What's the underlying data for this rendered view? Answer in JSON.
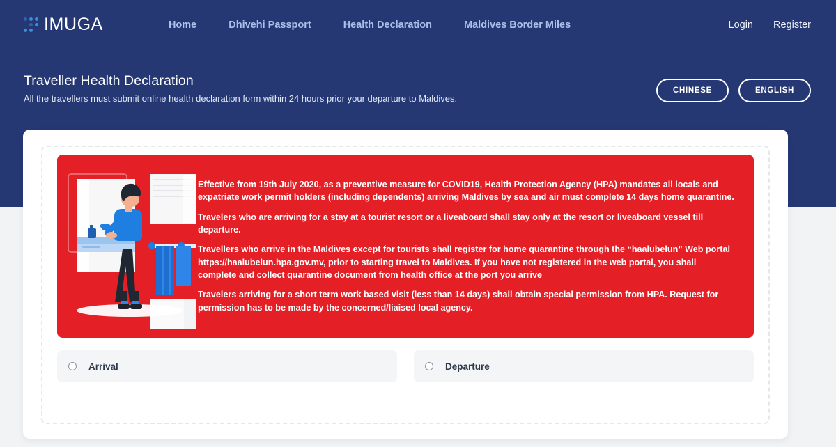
{
  "navbar": {
    "brand": "IMUGA",
    "brand_icon": "dot-grid-logo-icon",
    "links": [
      {
        "label": "Home",
        "name": "nav-link-home"
      },
      {
        "label": "Dhivehi Passport",
        "name": "nav-link-dhivehi-passport"
      },
      {
        "label": "Health Declaration",
        "name": "nav-link-health-declaration"
      },
      {
        "label": "Maldives Border Miles",
        "name": "nav-link-maldives-border-miles"
      }
    ],
    "auth": [
      {
        "label": "Login",
        "name": "login-link"
      },
      {
        "label": "Register",
        "name": "register-link"
      }
    ]
  },
  "page_header": {
    "title": "Traveller Health Declaration",
    "subtitle": "All the travellers must submit online health declaration form within 24 hours prior your departure to Maldives.",
    "language_buttons": [
      {
        "label": "CHINESE",
        "name": "language-button-chinese"
      },
      {
        "label": "ENGLISH",
        "name": "language-button-english"
      }
    ]
  },
  "notice": {
    "illustration": "handwashing-illustration",
    "paragraphs": [
      "Effective from 19th July 2020, as a preventive measure for COVID19, Health Protection Agency (HPA) mandates all locals and expatriate work permit holders (including dependents) arriving Maldives by sea and air must complete 14 days home quarantine.",
      "Travelers who are arriving for a stay at a tourist resort or a liveaboard shall stay only at the resort or liveaboard vessel till departure.",
      "Travellers who arrive in the Maldives except for tourists shall register for home quarantine through the “haalubelun” Web portal https://haalubelun.hpa.gov.mv, prior to starting travel to Maldives. If you have not registered in the web portal, you shall complete and collect quarantine document from health office at the port you arrive",
      "Travelers arriving for a short term work based visit (less than 14 days) shall obtain special permission from HPA. Request for permission has to be made by the concerned/liaised local agency."
    ]
  },
  "declaration_type": {
    "options": [
      {
        "label": "Arrival",
        "name": "radio-option-arrival",
        "selected": false
      },
      {
        "label": "Departure",
        "name": "radio-option-departure",
        "selected": false
      }
    ]
  },
  "colors": {
    "header_blue": "#253874",
    "notice_red": "#e41f26",
    "nav_link_blue": "#a9c2e9",
    "page_background": "#f1f3f5",
    "card_white": "#ffffff",
    "option_grey": "#f4f5f7"
  }
}
